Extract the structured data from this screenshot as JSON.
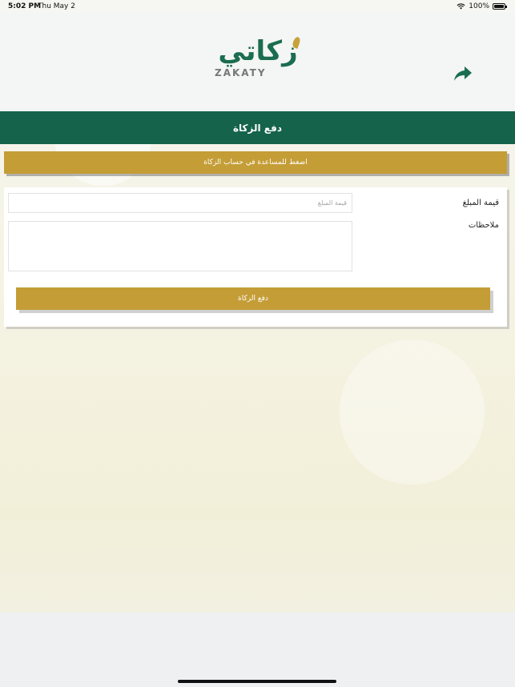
{
  "status_bar": {
    "time": "5:02 PM",
    "date": "Thu May 2",
    "battery": "100%"
  },
  "header": {
    "logo_arabic": "زكاتي",
    "logo_english": "ZAKATY",
    "forward_icon": "share-forward-icon"
  },
  "title_bar": {
    "title": "دفع الزكاة"
  },
  "help_button": {
    "label": "اضغط للمساعدة في حساب الزكاة"
  },
  "form": {
    "amount_label": "قيمة المبلغ",
    "amount_placeholder": "قيمة المبلغ",
    "amount_value": "",
    "notes_label": "ملاحظات",
    "notes_value": "",
    "submit_label": "دفع الزكاة"
  },
  "colors": {
    "primary_green": "#14634a",
    "gold": "#c49d36"
  }
}
